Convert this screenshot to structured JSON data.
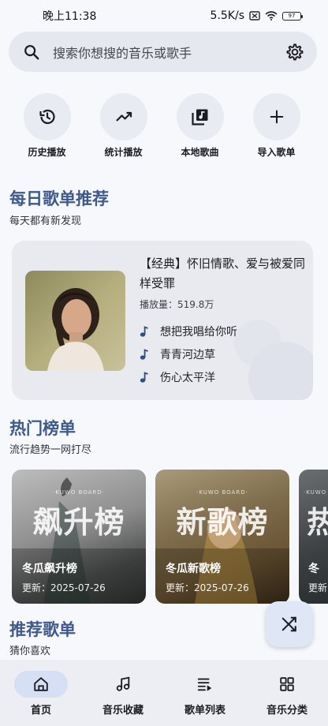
{
  "status": {
    "time": "晚上11:38",
    "speed": "5.5K/s",
    "battery": "97"
  },
  "search": {
    "placeholder": "搜索你想搜的音乐或歌手",
    "icon": "search-icon",
    "settings_icon": "gear-icon"
  },
  "quick_actions": [
    {
      "label": "历史播放",
      "icon": "history-icon"
    },
    {
      "label": "统计播放",
      "icon": "trending-icon"
    },
    {
      "label": "本地歌曲",
      "icon": "library-music-icon"
    },
    {
      "label": "导入歌单",
      "icon": "plus-icon"
    }
  ],
  "daily": {
    "title": "每日歌单推荐",
    "subtitle": "每天都有新发现",
    "playlist_title": "【经典】怀旧情歌、爱与被爱同样受罪",
    "play_count": "播放量：519.8万",
    "songs": [
      "想把我唱给你听",
      "青青河边草",
      "伤心太平洋"
    ]
  },
  "charts": {
    "title": "热门榜单",
    "subtitle": "流行趋势一网打尽",
    "items": [
      {
        "big": "飙升榜",
        "brand": "·KUWO BOARD·",
        "name": "冬瓜飙升榜",
        "update": "更新：2025-07-26"
      },
      {
        "big": "新歌榜",
        "brand": "·KUWO BOARD·",
        "name": "冬瓜新歌榜",
        "update": "更新：2025-07-26"
      },
      {
        "big": "热",
        "brand": "·KUWO BOARD·",
        "name": "冬",
        "update": "更新"
      }
    ]
  },
  "recommend": {
    "title": "推荐歌单",
    "subtitle": "猜你喜欢"
  },
  "fab": {
    "icon": "shuffle-icon"
  },
  "nav": [
    {
      "label": "首页",
      "icon": "home-icon",
      "active": true
    },
    {
      "label": "音乐收藏",
      "icon": "music-note-icon",
      "active": false
    },
    {
      "label": "歌单列表",
      "icon": "queue-list-icon",
      "active": false
    },
    {
      "label": "音乐分类",
      "icon": "grid-icon",
      "active": false
    }
  ],
  "colors": {
    "accent": "#3d5a8a",
    "background": "#f7f8fc",
    "nav_active": "#d6e0f4"
  }
}
